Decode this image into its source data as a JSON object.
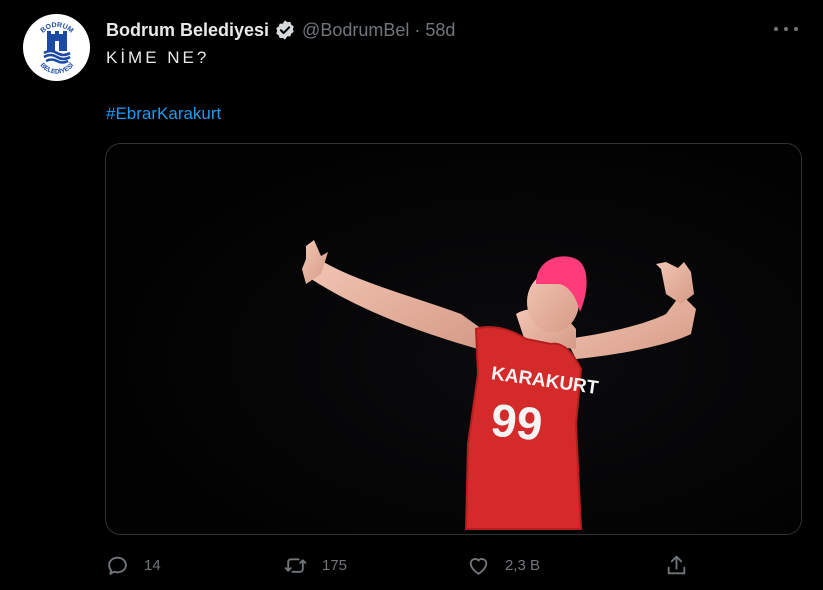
{
  "tweet": {
    "author_name": "Bodrum Belediyesi",
    "handle": "@BodrumBel",
    "separator": "·",
    "time": "58d",
    "text": "KİME NE?",
    "hashtag": "#EbrarKarakurt",
    "verified": true
  },
  "avatar": {
    "logo_text_top": "BODRUM",
    "logo_text_bottom": "BELEDİYESİ",
    "color": "#1b4aa5"
  },
  "media": {
    "jersey_name": "KARAKURT",
    "jersey_number": "99"
  },
  "actions": {
    "reply_count": "14",
    "retweet_count": "175",
    "like_count": "2,3 B"
  },
  "colors": {
    "background": "#000000",
    "text": "#e7e9ea",
    "muted": "#71767b",
    "link": "#1d9bf0",
    "jersey": "#d42a2a",
    "hair": "#ff3b7a"
  }
}
